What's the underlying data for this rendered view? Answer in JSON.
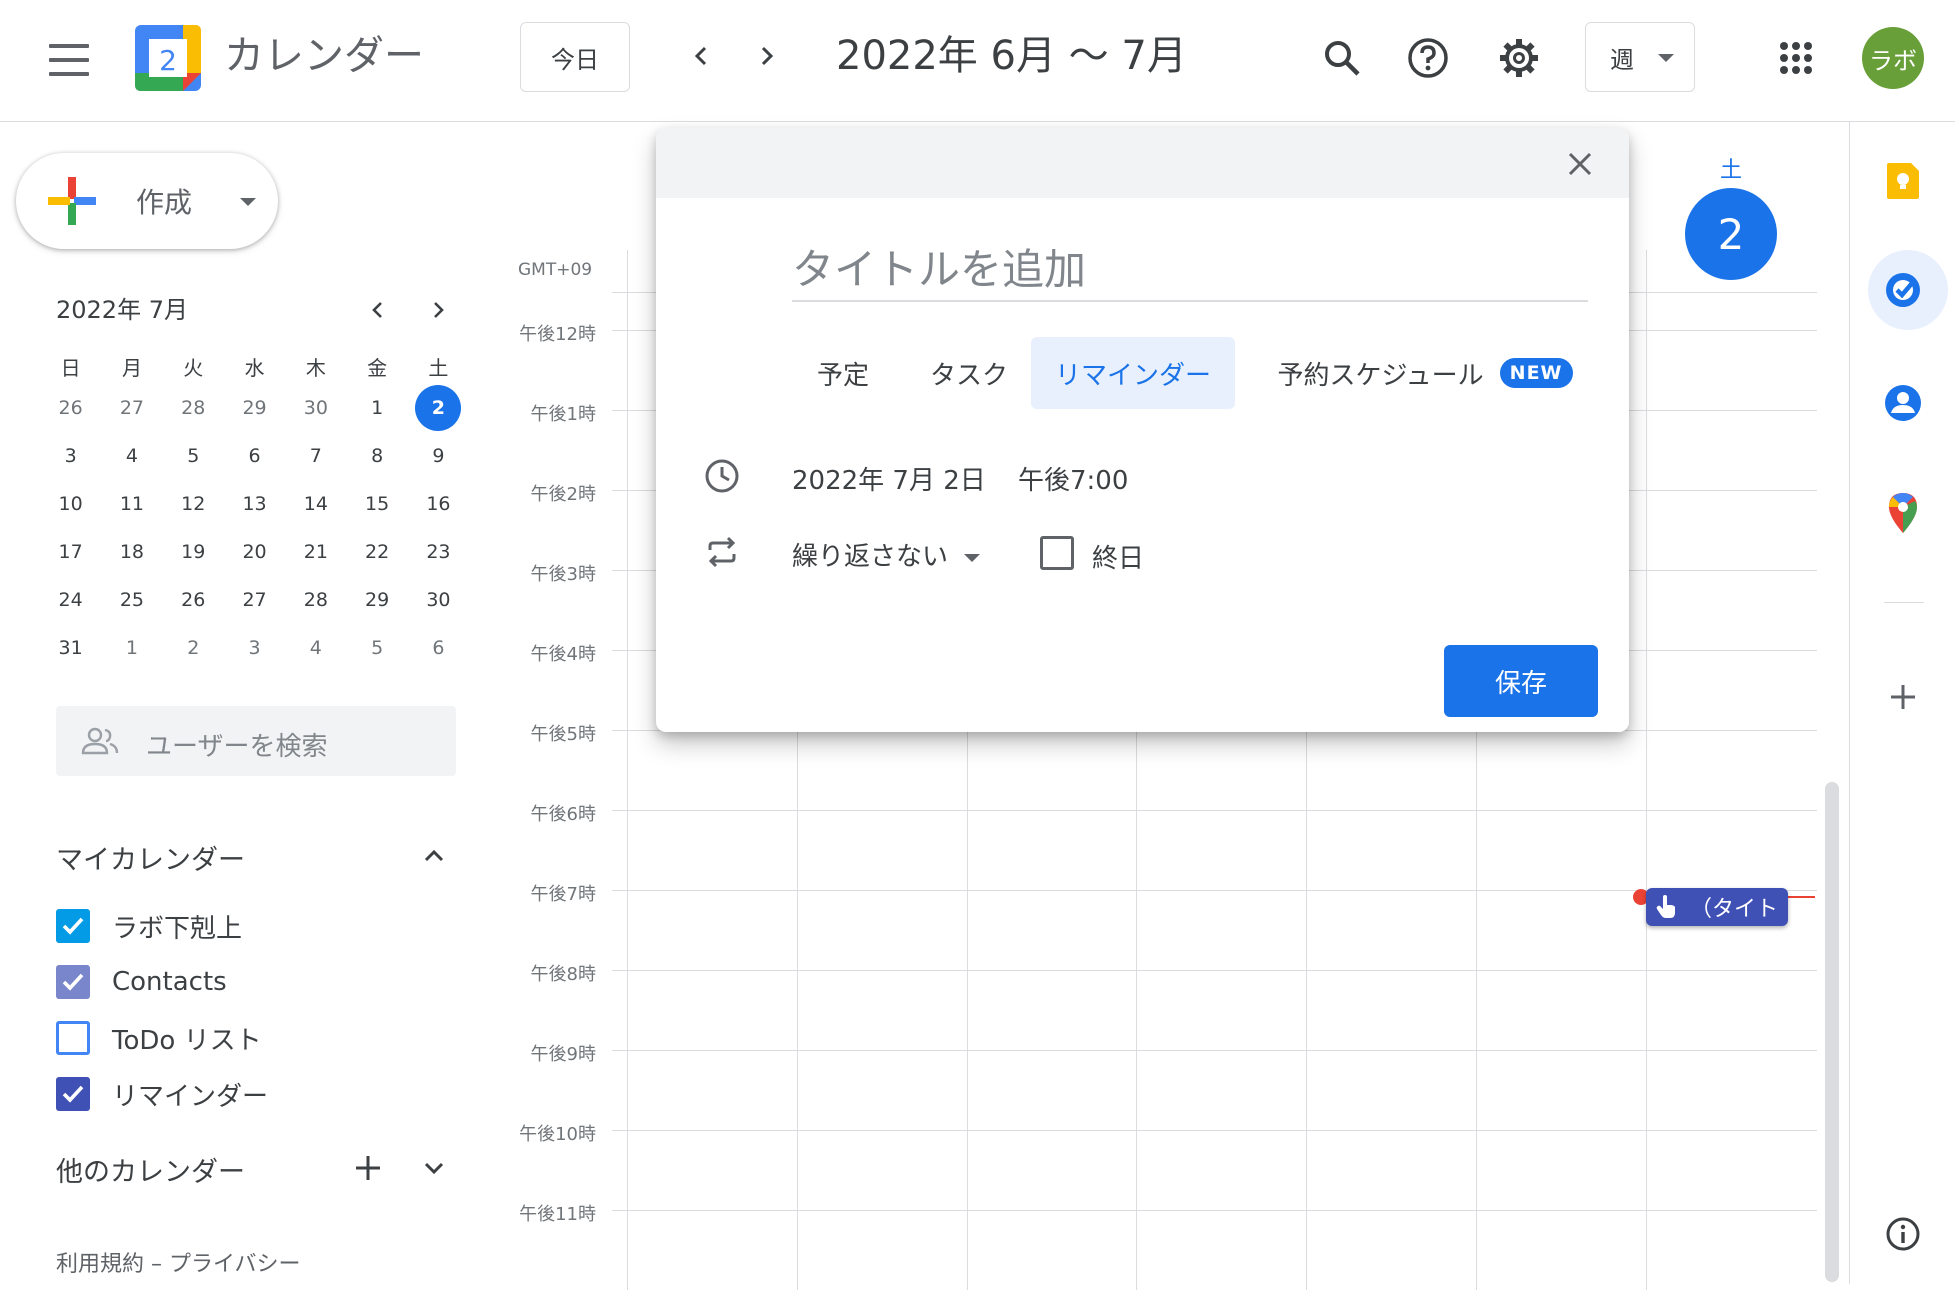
{
  "header": {
    "app_title": "カレンダー",
    "logo_number": "2",
    "today_label": "今日",
    "date_range": "2022年 6月 〜 7月",
    "view_label": "週",
    "avatar_text": "ラボ"
  },
  "sidebar": {
    "create_label": "作成",
    "mini_calendar": {
      "title": "2022年 7月",
      "weekdays": [
        "日",
        "月",
        "火",
        "水",
        "木",
        "金",
        "土"
      ],
      "weeks": [
        [
          "26",
          "27",
          "28",
          "29",
          "30",
          "1",
          "2"
        ],
        [
          "3",
          "4",
          "5",
          "6",
          "7",
          "8",
          "9"
        ],
        [
          "10",
          "11",
          "12",
          "13",
          "14",
          "15",
          "16"
        ],
        [
          "17",
          "18",
          "19",
          "20",
          "21",
          "22",
          "23"
        ],
        [
          "24",
          "25",
          "26",
          "27",
          "28",
          "29",
          "30"
        ],
        [
          "31",
          "1",
          "2",
          "3",
          "4",
          "5",
          "6"
        ]
      ],
      "selected": "2"
    },
    "user_search_placeholder": "ユーザーを検索",
    "my_calendars_title": "マイカレンダー",
    "my_calendars": [
      {
        "name": "ラボ下剋上",
        "checked": true,
        "color": "#039be5"
      },
      {
        "name": "Contacts",
        "checked": true,
        "color": "#7986cb"
      },
      {
        "name": "ToDo リスト",
        "checked": false,
        "color": "#4285f4"
      },
      {
        "name": "リマインダー",
        "checked": true,
        "color": "#3f51b5"
      }
    ],
    "other_calendars_title": "他のカレンダー",
    "footer": "利用規約 – プライバシー"
  },
  "grid": {
    "timezone": "GMT+09",
    "hours": [
      "午後12時",
      "午後1時",
      "午後2時",
      "午後3時",
      "午後4時",
      "午後5時",
      "午後6時",
      "午後7時",
      "午後8時",
      "午後9時",
      "午後10時",
      "午後11時"
    ],
    "day_name": "土",
    "day_number": "2",
    "event_chip": "（タイト"
  },
  "dialog": {
    "title_placeholder": "タイトルを追加",
    "tabs": [
      "予定",
      "タスク",
      "リマインダー",
      "予約スケジュール"
    ],
    "active_tab": "リマインダー",
    "new_badge": "NEW",
    "date": "2022年 7月 2日",
    "time": "午後7:00",
    "repeat": "繰り返さない",
    "all_day": "終日",
    "save_label": "保存"
  },
  "colors": {
    "accent": "#1a73e8",
    "now_line": "#ea4335",
    "avatar_bg": "#689f38",
    "chip_bg": "#3f51b5"
  },
  "icons": [
    "menu-icon",
    "calendar-logo",
    "chevron-left-icon",
    "chevron-right-icon",
    "search-icon",
    "help-icon",
    "gear-icon",
    "apps-grid-icon",
    "close-icon",
    "clock-icon",
    "repeat-icon",
    "keep-icon",
    "tasks-icon",
    "contacts-icon",
    "maps-icon",
    "add-icon",
    "info-icon",
    "people-icon"
  ]
}
